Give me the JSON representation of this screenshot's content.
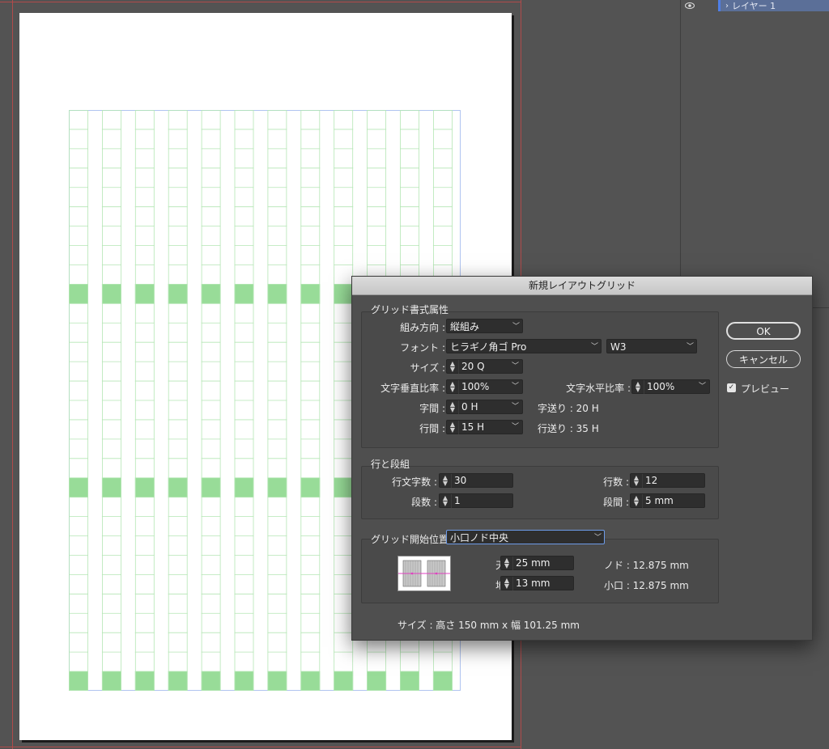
{
  "layers": {
    "layer_name": "レイヤー 1"
  },
  "dialog": {
    "title": "新規レイアウトグリッド",
    "grid_attrs": {
      "title": "グリッド書式属性",
      "direction_label": "組み方向 :",
      "direction_value": "縦組み",
      "font_label": "フォント :",
      "font_family": "ヒラギノ角ゴ Pro",
      "font_weight": "W3",
      "size_label": "サイズ :",
      "size_value": "20 Q",
      "vscale_label": "文字垂直比率 :",
      "vscale_value": "100%",
      "hscale_label": "文字水平比率 :",
      "hscale_value": "100%",
      "char_gap_label": "字間 :",
      "char_gap_value": "0 H",
      "char_pitch": "字送り : 20 H",
      "line_gap_label": "行間 :",
      "line_gap_value": "15 H",
      "line_pitch": "行送り : 35 H"
    },
    "lines_columns": {
      "title": "行と段組",
      "chars_per_line_label": "行文字数 :",
      "chars_per_line_value": "30",
      "lines_label": "行数 :",
      "lines_value": "12",
      "columns_label": "段数 :",
      "columns_value": "1",
      "gutter_label": "段間 :",
      "gutter_value": "5 mm"
    },
    "start_position": {
      "label": "グリッド開始位置 :",
      "value": "小口ノド中央",
      "top_label": "天 :",
      "top_value": "25 mm",
      "bottom_label": "地 :",
      "bottom_value": "13 mm",
      "gutter_info": "ノド : 12.875 mm",
      "fore_edge_info": "小口 : 12.875 mm"
    },
    "size_summary": "サイズ : 高さ 150 mm x 幅 101.25 mm",
    "ok_label": "OK",
    "cancel_label": "キャンセル",
    "preview_label": "プレビュー",
    "preview_checked": true
  },
  "grid": {
    "columns": 12,
    "chars_per_column": 30,
    "highlight_color": "#98dc98",
    "line_color": "#b4e6b4",
    "frame_color": "#b0c4f0"
  }
}
